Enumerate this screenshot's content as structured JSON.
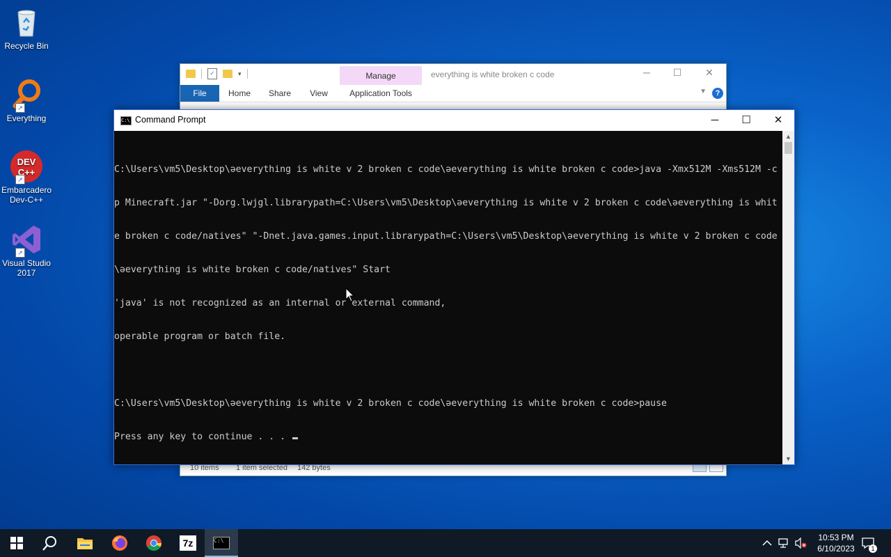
{
  "desktop": {
    "icons": [
      {
        "label": "Recycle Bin"
      },
      {
        "label": "Everything"
      },
      {
        "label": "Embarcadero Dev-C++",
        "logo_text": "DEV C++"
      },
      {
        "label": "Visual Studio 2017"
      }
    ]
  },
  "explorer": {
    "manage_tab": "Manage",
    "title": "everything is white broken c code",
    "tabs": [
      "File",
      "Home",
      "Share",
      "View",
      "Application Tools"
    ],
    "help": "?",
    "status": {
      "items": "10 items",
      "selected": "1 item selected",
      "size": "142 bytes"
    }
  },
  "cmd": {
    "title": "Command Prompt",
    "icon_text": "C:\\",
    "lines": [
      "C:\\Users\\vm5\\Desktop\\ǝeverything is white v 2 broken c code\\ǝeverything is white broken c code>java -Xmx512M -Xms512M -c",
      "p Minecraft.jar \"-Dorg.lwjgl.librarypath=C:\\Users\\vm5\\Desktop\\ǝeverything is white v 2 broken c code\\ǝeverything is whit",
      "e broken c code/natives\" \"-Dnet.java.games.input.librarypath=C:\\Users\\vm5\\Desktop\\ǝeverything is white v 2 broken c code",
      "\\ǝeverything is white broken c code/natives\" Start",
      "'java' is not recognized as an internal or external command,",
      "operable program or batch file.",
      "",
      "C:\\Users\\vm5\\Desktop\\ǝeverything is white v 2 broken c code\\ǝeverything is white broken c code>pause",
      "Press any key to continue . . . "
    ],
    "controls": {
      "minimize": "─",
      "maximize": "☐",
      "close": "✕"
    }
  },
  "taskbar": {
    "items": [
      "start",
      "search",
      "file-explorer",
      "firefox",
      "chrome",
      "7-zip",
      "command-prompt"
    ],
    "sevenzip_label": "7z",
    "clock": {
      "time": "10:53 PM",
      "date": "6/10/2023"
    },
    "notification_count": "1"
  },
  "colors": {
    "desktop_blue": "#0a63c9",
    "taskbar": "#0f1a26",
    "console_bg": "#0c0c0c",
    "console_text": "#cccccc",
    "explorer_file_tab": "#1a64b4",
    "manage_tab": "#f3d9f7"
  }
}
